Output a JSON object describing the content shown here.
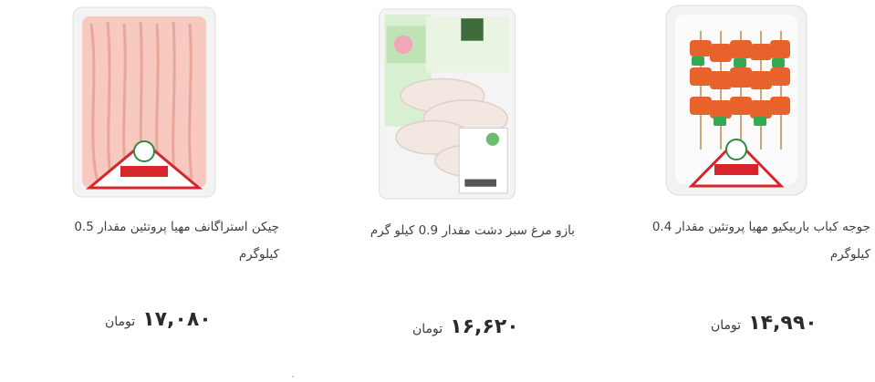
{
  "products": [
    {
      "title": "چیکن استراگانف مهیا پروتئین مقدار 0.5 کیلوگرم",
      "price": "۱۷,۰۸۰",
      "currency": "تومان",
      "brand_label": "مهیا پروتئین"
    },
    {
      "title": "بازو مرغ سبز دشت مقدار 0.9 کیلو گرم",
      "price": "۱۶,۶۲۰",
      "currency": "تومان",
      "brand_label": "سبزدشت"
    },
    {
      "title": "جوجه کباب باربیکیو مهیا پروتئین مقدار 0.4 کیلوگرم",
      "price": "۱۴,۹۹۰",
      "currency": "تومان",
      "brand_label": "مهیا پروتئین"
    }
  ],
  "colors": {
    "price_text": "#2b2b2b",
    "title_text": "#3f3f3f",
    "brand_red": "#d6262b",
    "brand_green": "#2e8b3e"
  }
}
